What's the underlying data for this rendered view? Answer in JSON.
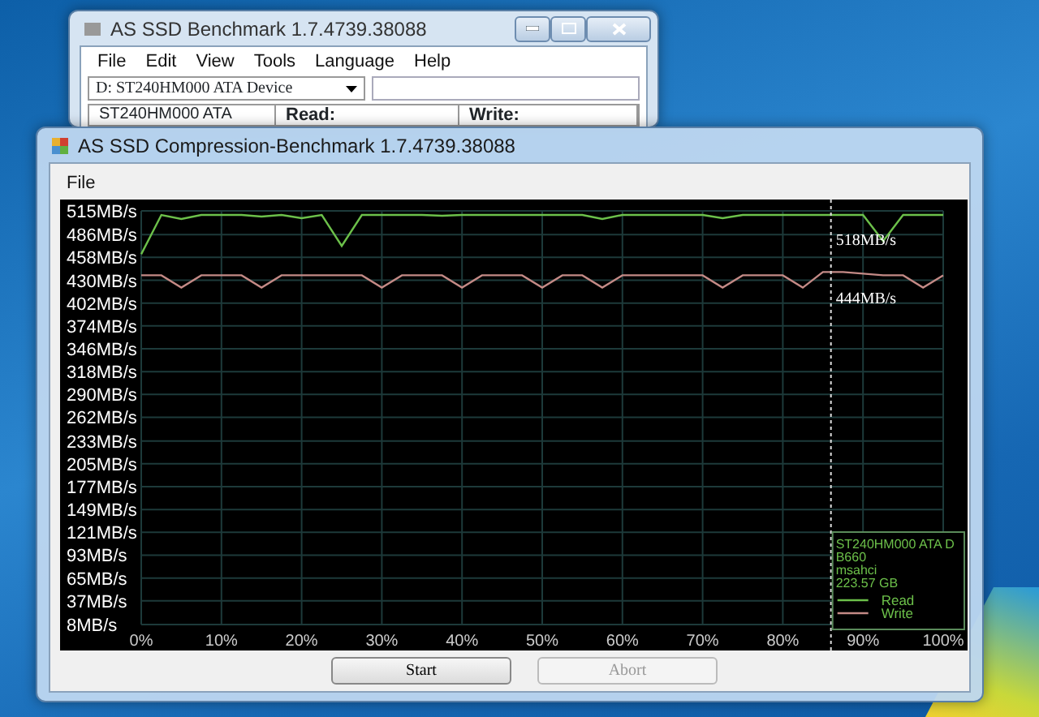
{
  "back_window": {
    "title": "AS SSD Benchmark 1.7.4739.38088",
    "menu": [
      "File",
      "Edit",
      "View",
      "Tools",
      "Language",
      "Help"
    ],
    "drive_select": {
      "value": "D: ST240HM000 ATA Device"
    },
    "header": [
      "ST240HM000 ATA",
      "Read:",
      "Write:"
    ]
  },
  "window": {
    "title": "AS SSD Compression-Benchmark 1.7.4739.38088",
    "menu": [
      "File"
    ],
    "chart": {
      "chart_data": {
        "type": "line",
        "x": [
          0,
          2.5,
          5,
          7.5,
          10,
          12.5,
          15,
          17.5,
          20,
          22.5,
          25,
          27.5,
          30,
          32.5,
          35,
          37.5,
          40,
          42.5,
          45,
          47.5,
          50,
          52.5,
          55,
          57.5,
          60,
          62.5,
          65,
          67.5,
          70,
          72.5,
          75,
          77.5,
          80,
          82.5,
          85,
          87.5,
          90,
          92.5,
          95,
          97.5,
          100
        ],
        "series": [
          {
            "name": "Read",
            "color": "#6cc04a",
            "values": [
              462,
              510,
              505,
              510,
              510,
              510,
              508,
              510,
              506,
              510,
              472,
              510,
              510,
              510,
              510,
              509,
              510,
              510,
              510,
              510,
              510,
              510,
              510,
              505,
              510,
              510,
              510,
              510,
              510,
              506,
              510,
              510,
              510,
              510,
              510,
              510,
              510,
              478,
              510,
              510,
              510
            ]
          },
          {
            "name": "Write",
            "color": "#c48a86",
            "values": [
              436,
              436,
              421,
              436,
              436,
              436,
              421,
              436,
              436,
              436,
              436,
              436,
              421,
              436,
              436,
              436,
              421,
              436,
              436,
              436,
              421,
              436,
              436,
              421,
              436,
              436,
              436,
              436,
              436,
              421,
              436,
              436,
              436,
              421,
              440,
              440,
              438,
              436,
              436,
              421,
              436
            ]
          }
        ],
        "xlim": [
          0,
          100
        ],
        "ylim": [
          8,
          515
        ],
        "xticks": [
          {
            "value": 0,
            "label": "0%"
          },
          {
            "value": 10,
            "label": "10%"
          },
          {
            "value": 20,
            "label": "20%"
          },
          {
            "value": 30,
            "label": "30%"
          },
          {
            "value": 40,
            "label": "40%"
          },
          {
            "value": 50,
            "label": "50%"
          },
          {
            "value": 60,
            "label": "60%"
          },
          {
            "value": 70,
            "label": "70%"
          },
          {
            "value": 80,
            "label": "80%"
          },
          {
            "value": 90,
            "label": "90%"
          },
          {
            "value": 100,
            "label": "100%"
          }
        ],
        "yticks": [
          {
            "value": 515,
            "label": "515MB/s"
          },
          {
            "value": 486,
            "label": "486MB/s"
          },
          {
            "value": 458,
            "label": "458MB/s"
          },
          {
            "value": 430,
            "label": "430MB/s"
          },
          {
            "value": 402,
            "label": "402MB/s"
          },
          {
            "value": 374,
            "label": "374MB/s"
          },
          {
            "value": 346,
            "label": "346MB/s"
          },
          {
            "value": 318,
            "label": "318MB/s"
          },
          {
            "value": 290,
            "label": "290MB/s"
          },
          {
            "value": 262,
            "label": "262MB/s"
          },
          {
            "value": 233,
            "label": "233MB/s"
          },
          {
            "value": 205,
            "label": "205MB/s"
          },
          {
            "value": 177,
            "label": "177MB/s"
          },
          {
            "value": 149,
            "label": "149MB/s"
          },
          {
            "value": 121,
            "label": "121MB/s"
          },
          {
            "value": 93,
            "label": "93MB/s"
          },
          {
            "value": 65,
            "label": "65MB/s"
          },
          {
            "value": 37,
            "label": "37MB/s"
          },
          {
            "value": 8,
            "label": "8MB/s"
          }
        ],
        "grid": true,
        "legend": true,
        "ref_lines": [
          {
            "axis": "x",
            "value": 86
          }
        ],
        "annotations": [
          "518MB/s",
          "444MB/s"
        ]
      },
      "legend_info": [
        "ST240HM000 ATA D",
        "B660",
        "msahci",
        "223.57 GB"
      ]
    },
    "buttons": [
      {
        "label": "Start",
        "disabled": false
      },
      {
        "label": "Abort",
        "disabled": true
      }
    ]
  }
}
